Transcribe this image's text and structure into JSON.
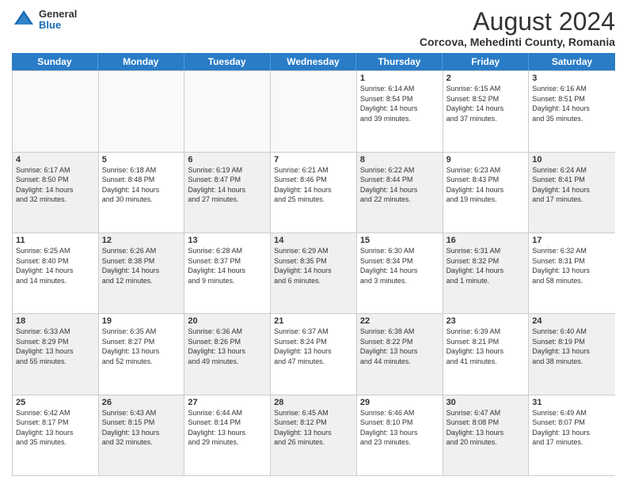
{
  "logo": {
    "general": "General",
    "blue": "Blue"
  },
  "title": "August 2024",
  "subtitle": "Corcova, Mehedinti County, Romania",
  "header_days": [
    "Sunday",
    "Monday",
    "Tuesday",
    "Wednesday",
    "Thursday",
    "Friday",
    "Saturday"
  ],
  "rows": [
    [
      {
        "day": "",
        "empty": true
      },
      {
        "day": "",
        "empty": true
      },
      {
        "day": "",
        "empty": true
      },
      {
        "day": "",
        "empty": true
      },
      {
        "day": "1",
        "line1": "Sunrise: 6:14 AM",
        "line2": "Sunset: 8:54 PM",
        "line3": "Daylight: 14 hours",
        "line4": "and 39 minutes."
      },
      {
        "day": "2",
        "line1": "Sunrise: 6:15 AM",
        "line2": "Sunset: 8:52 PM",
        "line3": "Daylight: 14 hours",
        "line4": "and 37 minutes."
      },
      {
        "day": "3",
        "line1": "Sunrise: 6:16 AM",
        "line2": "Sunset: 8:51 PM",
        "line3": "Daylight: 14 hours",
        "line4": "and 35 minutes."
      }
    ],
    [
      {
        "day": "4",
        "shaded": true,
        "line1": "Sunrise: 6:17 AM",
        "line2": "Sunset: 8:50 PM",
        "line3": "Daylight: 14 hours",
        "line4": "and 32 minutes."
      },
      {
        "day": "5",
        "line1": "Sunrise: 6:18 AM",
        "line2": "Sunset: 8:48 PM",
        "line3": "Daylight: 14 hours",
        "line4": "and 30 minutes."
      },
      {
        "day": "6",
        "shaded": true,
        "line1": "Sunrise: 6:19 AM",
        "line2": "Sunset: 8:47 PM",
        "line3": "Daylight: 14 hours",
        "line4": "and 27 minutes."
      },
      {
        "day": "7",
        "line1": "Sunrise: 6:21 AM",
        "line2": "Sunset: 8:46 PM",
        "line3": "Daylight: 14 hours",
        "line4": "and 25 minutes."
      },
      {
        "day": "8",
        "shaded": true,
        "line1": "Sunrise: 6:22 AM",
        "line2": "Sunset: 8:44 PM",
        "line3": "Daylight: 14 hours",
        "line4": "and 22 minutes."
      },
      {
        "day": "9",
        "line1": "Sunrise: 6:23 AM",
        "line2": "Sunset: 8:43 PM",
        "line3": "Daylight: 14 hours",
        "line4": "and 19 minutes."
      },
      {
        "day": "10",
        "shaded": true,
        "line1": "Sunrise: 6:24 AM",
        "line2": "Sunset: 8:41 PM",
        "line3": "Daylight: 14 hours",
        "line4": "and 17 minutes."
      }
    ],
    [
      {
        "day": "11",
        "line1": "Sunrise: 6:25 AM",
        "line2": "Sunset: 8:40 PM",
        "line3": "Daylight: 14 hours",
        "line4": "and 14 minutes."
      },
      {
        "day": "12",
        "shaded": true,
        "line1": "Sunrise: 6:26 AM",
        "line2": "Sunset: 8:38 PM",
        "line3": "Daylight: 14 hours",
        "line4": "and 12 minutes."
      },
      {
        "day": "13",
        "line1": "Sunrise: 6:28 AM",
        "line2": "Sunset: 8:37 PM",
        "line3": "Daylight: 14 hours",
        "line4": "and 9 minutes."
      },
      {
        "day": "14",
        "shaded": true,
        "line1": "Sunrise: 6:29 AM",
        "line2": "Sunset: 8:35 PM",
        "line3": "Daylight: 14 hours",
        "line4": "and 6 minutes."
      },
      {
        "day": "15",
        "line1": "Sunrise: 6:30 AM",
        "line2": "Sunset: 8:34 PM",
        "line3": "Daylight: 14 hours",
        "line4": "and 3 minutes."
      },
      {
        "day": "16",
        "shaded": true,
        "line1": "Sunrise: 6:31 AM",
        "line2": "Sunset: 8:32 PM",
        "line3": "Daylight: 14 hours",
        "line4": "and 1 minute."
      },
      {
        "day": "17",
        "line1": "Sunrise: 6:32 AM",
        "line2": "Sunset: 8:31 PM",
        "line3": "Daylight: 13 hours",
        "line4": "and 58 minutes."
      }
    ],
    [
      {
        "day": "18",
        "shaded": true,
        "line1": "Sunrise: 6:33 AM",
        "line2": "Sunset: 8:29 PM",
        "line3": "Daylight: 13 hours",
        "line4": "and 55 minutes."
      },
      {
        "day": "19",
        "line1": "Sunrise: 6:35 AM",
        "line2": "Sunset: 8:27 PM",
        "line3": "Daylight: 13 hours",
        "line4": "and 52 minutes."
      },
      {
        "day": "20",
        "shaded": true,
        "line1": "Sunrise: 6:36 AM",
        "line2": "Sunset: 8:26 PM",
        "line3": "Daylight: 13 hours",
        "line4": "and 49 minutes."
      },
      {
        "day": "21",
        "line1": "Sunrise: 6:37 AM",
        "line2": "Sunset: 8:24 PM",
        "line3": "Daylight: 13 hours",
        "line4": "and 47 minutes."
      },
      {
        "day": "22",
        "shaded": true,
        "line1": "Sunrise: 6:38 AM",
        "line2": "Sunset: 8:22 PM",
        "line3": "Daylight: 13 hours",
        "line4": "and 44 minutes."
      },
      {
        "day": "23",
        "line1": "Sunrise: 6:39 AM",
        "line2": "Sunset: 8:21 PM",
        "line3": "Daylight: 13 hours",
        "line4": "and 41 minutes."
      },
      {
        "day": "24",
        "shaded": true,
        "line1": "Sunrise: 6:40 AM",
        "line2": "Sunset: 8:19 PM",
        "line3": "Daylight: 13 hours",
        "line4": "and 38 minutes."
      }
    ],
    [
      {
        "day": "25",
        "line1": "Sunrise: 6:42 AM",
        "line2": "Sunset: 8:17 PM",
        "line3": "Daylight: 13 hours",
        "line4": "and 35 minutes."
      },
      {
        "day": "26",
        "shaded": true,
        "line1": "Sunrise: 6:43 AM",
        "line2": "Sunset: 8:15 PM",
        "line3": "Daylight: 13 hours",
        "line4": "and 32 minutes."
      },
      {
        "day": "27",
        "line1": "Sunrise: 6:44 AM",
        "line2": "Sunset: 8:14 PM",
        "line3": "Daylight: 13 hours",
        "line4": "and 29 minutes."
      },
      {
        "day": "28",
        "shaded": true,
        "line1": "Sunrise: 6:45 AM",
        "line2": "Sunset: 8:12 PM",
        "line3": "Daylight: 13 hours",
        "line4": "and 26 minutes."
      },
      {
        "day": "29",
        "line1": "Sunrise: 6:46 AM",
        "line2": "Sunset: 8:10 PM",
        "line3": "Daylight: 13 hours",
        "line4": "and 23 minutes."
      },
      {
        "day": "30",
        "shaded": true,
        "line1": "Sunrise: 6:47 AM",
        "line2": "Sunset: 8:08 PM",
        "line3": "Daylight: 13 hours",
        "line4": "and 20 minutes."
      },
      {
        "day": "31",
        "line1": "Sunrise: 6:49 AM",
        "line2": "Sunset: 8:07 PM",
        "line3": "Daylight: 13 hours",
        "line4": "and 17 minutes."
      }
    ]
  ]
}
